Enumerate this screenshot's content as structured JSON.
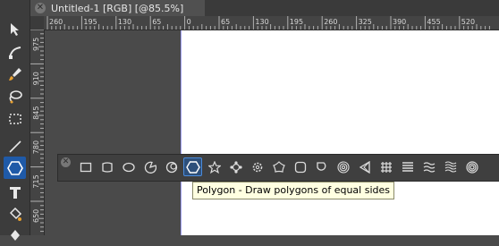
{
  "document_tab": {
    "close_glyph": "✕",
    "title": "Untitled-1 [RGB] [@85.5%]"
  },
  "rulers": {
    "horizontal_labels": [
      "260",
      "195",
      "130",
      "65",
      "0",
      "65",
      "130",
      "195",
      "260",
      "325",
      "390",
      "455",
      "520"
    ],
    "vertical_labels": [
      "975",
      "910",
      "845",
      "780",
      "715",
      "650"
    ]
  },
  "toolbox": {
    "tools": [
      {
        "icon": "move-tool-icon"
      },
      {
        "icon": "node-tool-icon"
      },
      {
        "icon": "brush-icon"
      },
      {
        "icon": "lasso-icon"
      },
      {
        "icon": "marquee-icon"
      },
      {
        "icon": "line-tool-icon"
      },
      {
        "icon": "hexagon-icon",
        "active": true
      },
      {
        "icon": "text-tool-icon"
      },
      {
        "icon": "fill-tool-icon"
      },
      {
        "icon": "pen-nib-icon"
      }
    ]
  },
  "shapes_bar": {
    "close_glyph": "✕",
    "shapes": [
      "rectangle-icon",
      "rounded-rectangle-icon",
      "ellipse-icon",
      "pie-icon",
      "crescent-icon",
      "polygon-icon",
      "star-icon",
      "cog-icon",
      "gear-icon",
      "flower-icon",
      "rounded-square-icon",
      "tear-icon",
      "spiral-icon",
      "triangle-icon",
      "grid-icon",
      "lines-icon",
      "wave-icon",
      "double-wave-icon",
      "target-icon"
    ],
    "active_index": 5
  },
  "tooltip": {
    "text": "Polygon - Draw polygons of equal sides"
  },
  "colors": {
    "accent": "#1f5aa8",
    "tooltip_bg": "#ffffe1",
    "panel": "#3f3f3f"
  }
}
